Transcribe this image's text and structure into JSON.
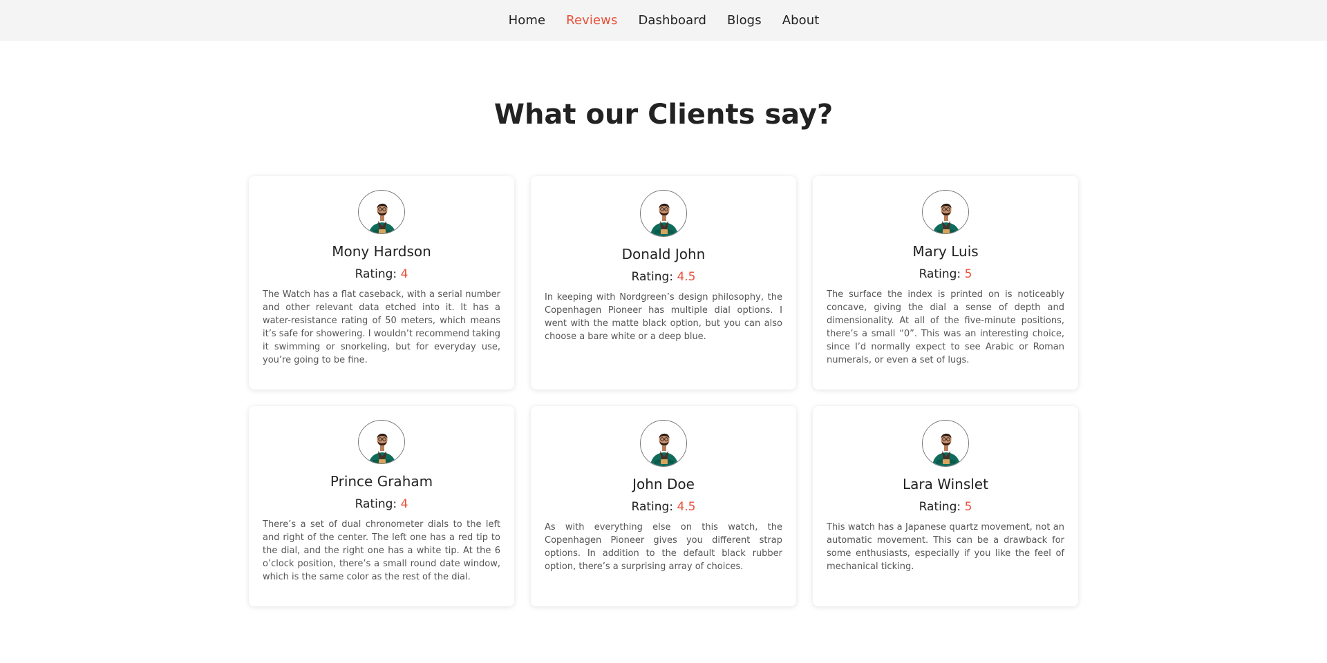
{
  "nav": {
    "items": [
      {
        "label": "Home",
        "active": false
      },
      {
        "label": "Reviews",
        "active": true
      },
      {
        "label": "Dashboard",
        "active": false
      },
      {
        "label": "Blogs",
        "active": false
      },
      {
        "label": "About",
        "active": false
      }
    ]
  },
  "heading": "What our Clients say?",
  "rating_label": "Rating:",
  "colors": {
    "accent": "#e9503a",
    "navbar_bg": "#f4f4f4",
    "text": "#222222",
    "body_text": "#555555"
  },
  "reviews": [
    {
      "name": "Mony Hardson",
      "rating": "4",
      "text": "The Watch has a flat caseback, with a serial number and other relevant data etched into it. It has a water-resistance rating of 50 meters, which means it’s safe for showering. I wouldn’t recommend taking it swimming or snorkeling, but for everyday use, you’re going to be fine."
    },
    {
      "name": "Donald John",
      "rating": "4.5",
      "text": "In keeping with Nordgreen’s design philosophy, the Copenhagen Pioneer has multiple dial options. I went with the matte black option, but you can also choose a bare white or a deep blue."
    },
    {
      "name": "Mary Luis",
      "rating": "5",
      "text": "The surface the index is printed on is noticeably concave, giving the dial a sense of depth and dimensionality. At all of the five-minute positions, there’s a small “0”. This was an interesting choice, since I’d normally expect to see Arabic or Roman numerals, or even a set of lugs."
    },
    {
      "name": "Prince Graham",
      "rating": "4",
      "text": "There’s a set of dual chronometer dials to the left and right of the center. The left one has a red tip to the dial, and the right one has a white tip. At the 6 o’clock position, there’s a small round date window, which is the same color as the rest of the dial."
    },
    {
      "name": "John Doe",
      "rating": "4.5",
      "text": "As with everything else on this watch, the Copenhagen Pioneer gives you different strap options. In addition to the default black rubber option, there’s a surprising array of choices."
    },
    {
      "name": "Lara Winslet",
      "rating": "5",
      "text": "This watch has a Japanese quartz movement, not an automatic movement. This can be a drawback for some enthusiasts, especially if you like the feel of mechanical ticking."
    }
  ]
}
